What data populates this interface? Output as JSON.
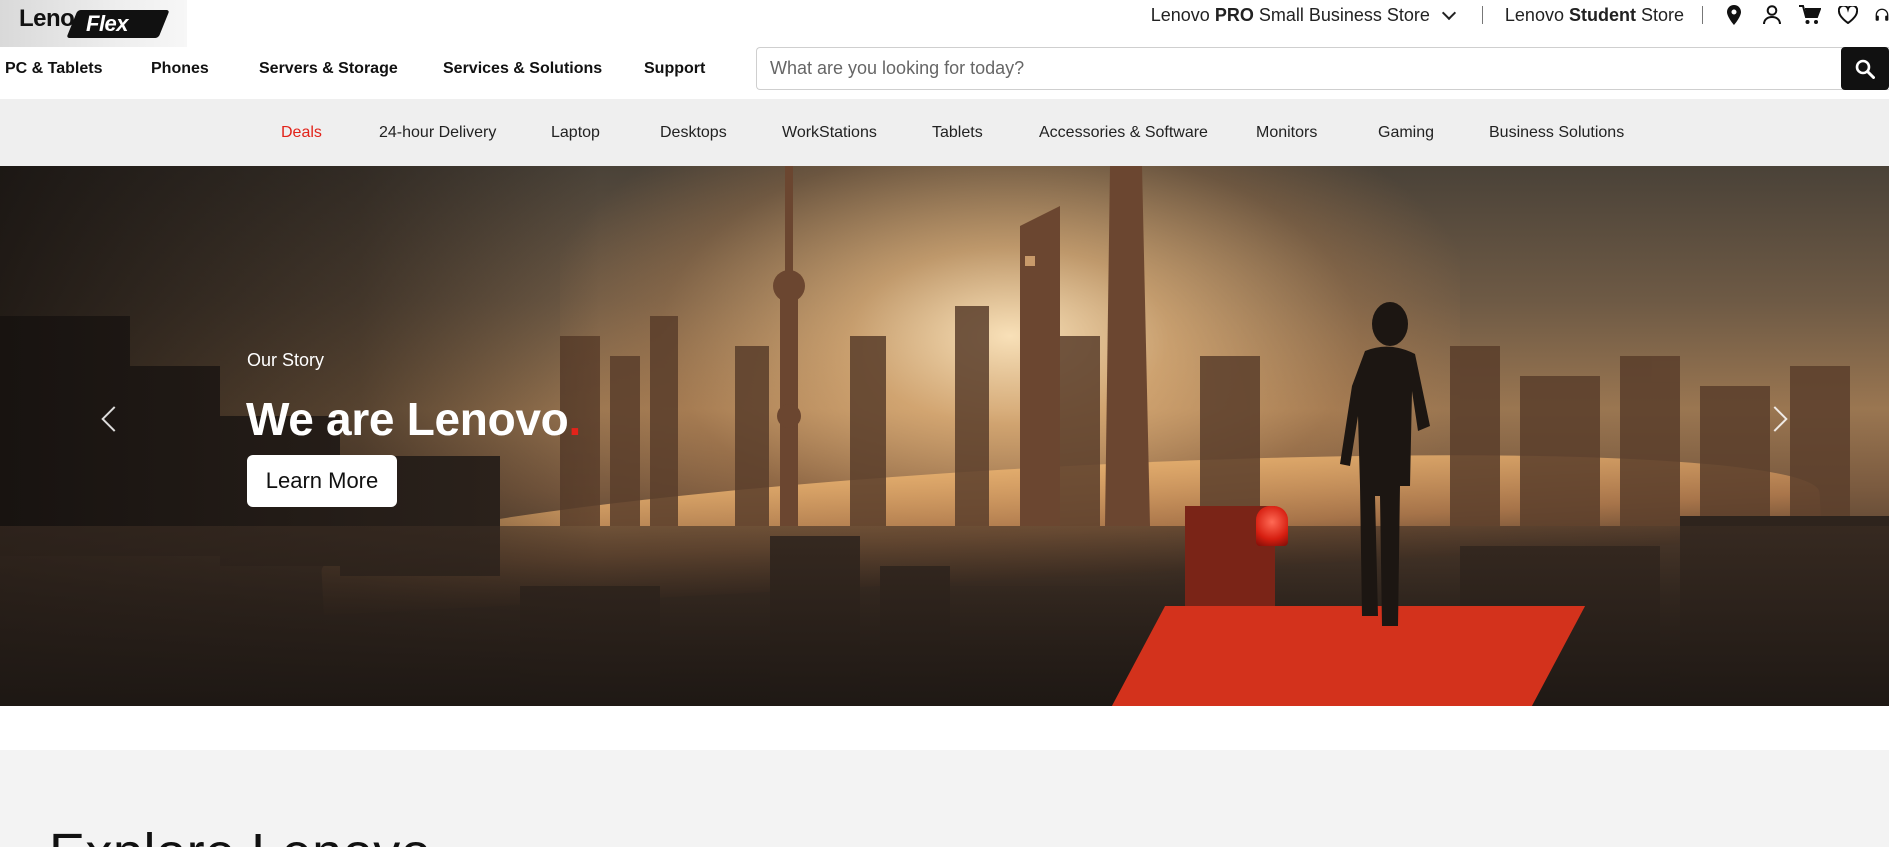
{
  "brand": {
    "logo_left": "Leno",
    "logo_right": "Flex"
  },
  "store_links": {
    "pro": {
      "prefix": "Lenovo",
      "bold": "PRO",
      "suffix": "Small Business Store"
    },
    "student": {
      "prefix": "Lenovo",
      "bold": "Student",
      "suffix": "Store"
    }
  },
  "header_icons": [
    "location-icon",
    "account-icon",
    "cart-icon",
    "wishlist-icon",
    "support-headset-icon"
  ],
  "main_nav": [
    {
      "label": "PC & Tablets"
    },
    {
      "label": "Phones"
    },
    {
      "label": "Servers & Storage"
    },
    {
      "label": "Services & Solutions"
    },
    {
      "label": "Support"
    }
  ],
  "search": {
    "placeholder": "What are you looking for today?",
    "value": ""
  },
  "categories": [
    {
      "label": "Deals",
      "active": true
    },
    {
      "label": "24-hour Delivery"
    },
    {
      "label": "Laptop"
    },
    {
      "label": "Desktops"
    },
    {
      "label": "WorkStations"
    },
    {
      "label": "Tablets"
    },
    {
      "label": "Accessories & Software"
    },
    {
      "label": "Monitors"
    },
    {
      "label": "Gaming"
    },
    {
      "label": "Business Solutions"
    }
  ],
  "hero": {
    "eyebrow": "Our Story",
    "headline": "We are Lenovo",
    "headline_dot": ".",
    "cta_label": "Learn More"
  },
  "explore": {
    "title": "Explore Lenovo"
  },
  "colors": {
    "accent_red": "#e2231a",
    "category_bar": "#efefef",
    "search_button": "#111111"
  }
}
